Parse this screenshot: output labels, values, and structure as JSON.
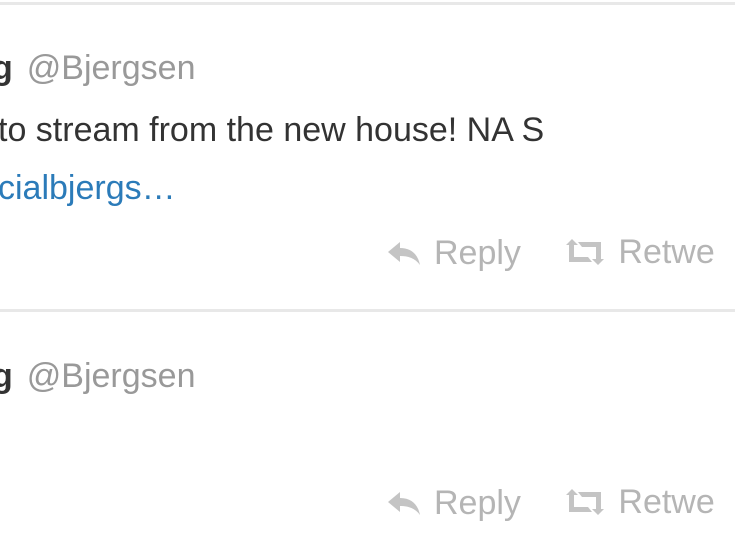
{
  "tweets": [
    {
      "display_name": "g",
      "handle": "@Bjergsen",
      "text": " to stream from the new house! NA S",
      "link_text": "cialbjergs…",
      "actions": {
        "reply_icon": "reply-arrow-icon",
        "reply_label": "Reply",
        "retweet_icon": "retweet-icon",
        "retweet_label": "Retwe"
      }
    },
    {
      "display_name": "g",
      "handle": "@Bjergsen",
      "text": "",
      "link_text": "",
      "actions": {
        "reply_icon": "reply-arrow-icon",
        "reply_label": "Reply",
        "retweet_icon": "retweet-icon",
        "retweet_label": "Retwe"
      }
    }
  ],
  "colors": {
    "name": "#333333",
    "handle": "#999999",
    "link": "#2b7bb9",
    "action": "#b5b5b5",
    "divider": "#e8e8e8"
  }
}
